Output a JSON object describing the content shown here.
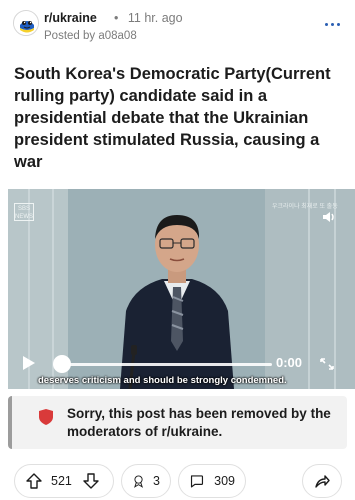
{
  "header": {
    "subreddit": "r/ukraine",
    "separator": "•",
    "age": "11 hr. ago",
    "posted_by": "Posted by a08a08"
  },
  "post": {
    "title": "South Korea's Democratic Party(Current rulling party) candidate said in a presidential debate that the Ukrainian president stimulated Russia, causing a war"
  },
  "video": {
    "caption": "deserves criticism and should be strongly condemned.",
    "time": "0:00",
    "logo_text": "SBS NEWS",
    "watermark": "우크라이나 최재로 또 출동",
    "progress": 0.0
  },
  "removed_notice": {
    "text": "Sorry, this post has been removed by the moderators of r/ukraine.",
    "icon": "shield-icon",
    "color": "#d93a3a"
  },
  "actions": {
    "votes": "521",
    "awards": "3",
    "comments": "309"
  },
  "colors": {
    "accent": "#2b5fb3",
    "text": "#1c1c1c",
    "muted": "#7c7c7c"
  }
}
